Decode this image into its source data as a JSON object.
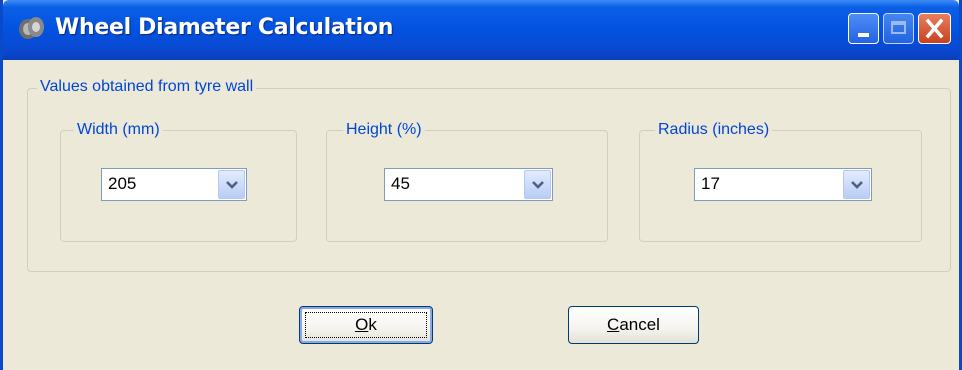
{
  "window": {
    "title": "Wheel Diameter Calculation",
    "icon": "tyre-icon"
  },
  "titlebar_buttons": {
    "minimize_icon": "minimize-icon",
    "maximize_icon": "maximize-icon",
    "close_icon": "close-icon"
  },
  "group": {
    "legend": "Values obtained from tyre wall"
  },
  "fields": [
    {
      "legend": "Width (mm)",
      "value": "205"
    },
    {
      "legend": "Height (%)",
      "value": "45"
    },
    {
      "legend": "Radius (inches)",
      "value": "17"
    }
  ],
  "buttons": {
    "ok": {
      "accel": "O",
      "rest": "k"
    },
    "cancel": {
      "accel": "C",
      "rest": "ancel"
    }
  },
  "colors": {
    "titlebar": "#0352e0",
    "legend_text": "#0046d5",
    "dialog_bg": "#ece9d8"
  }
}
